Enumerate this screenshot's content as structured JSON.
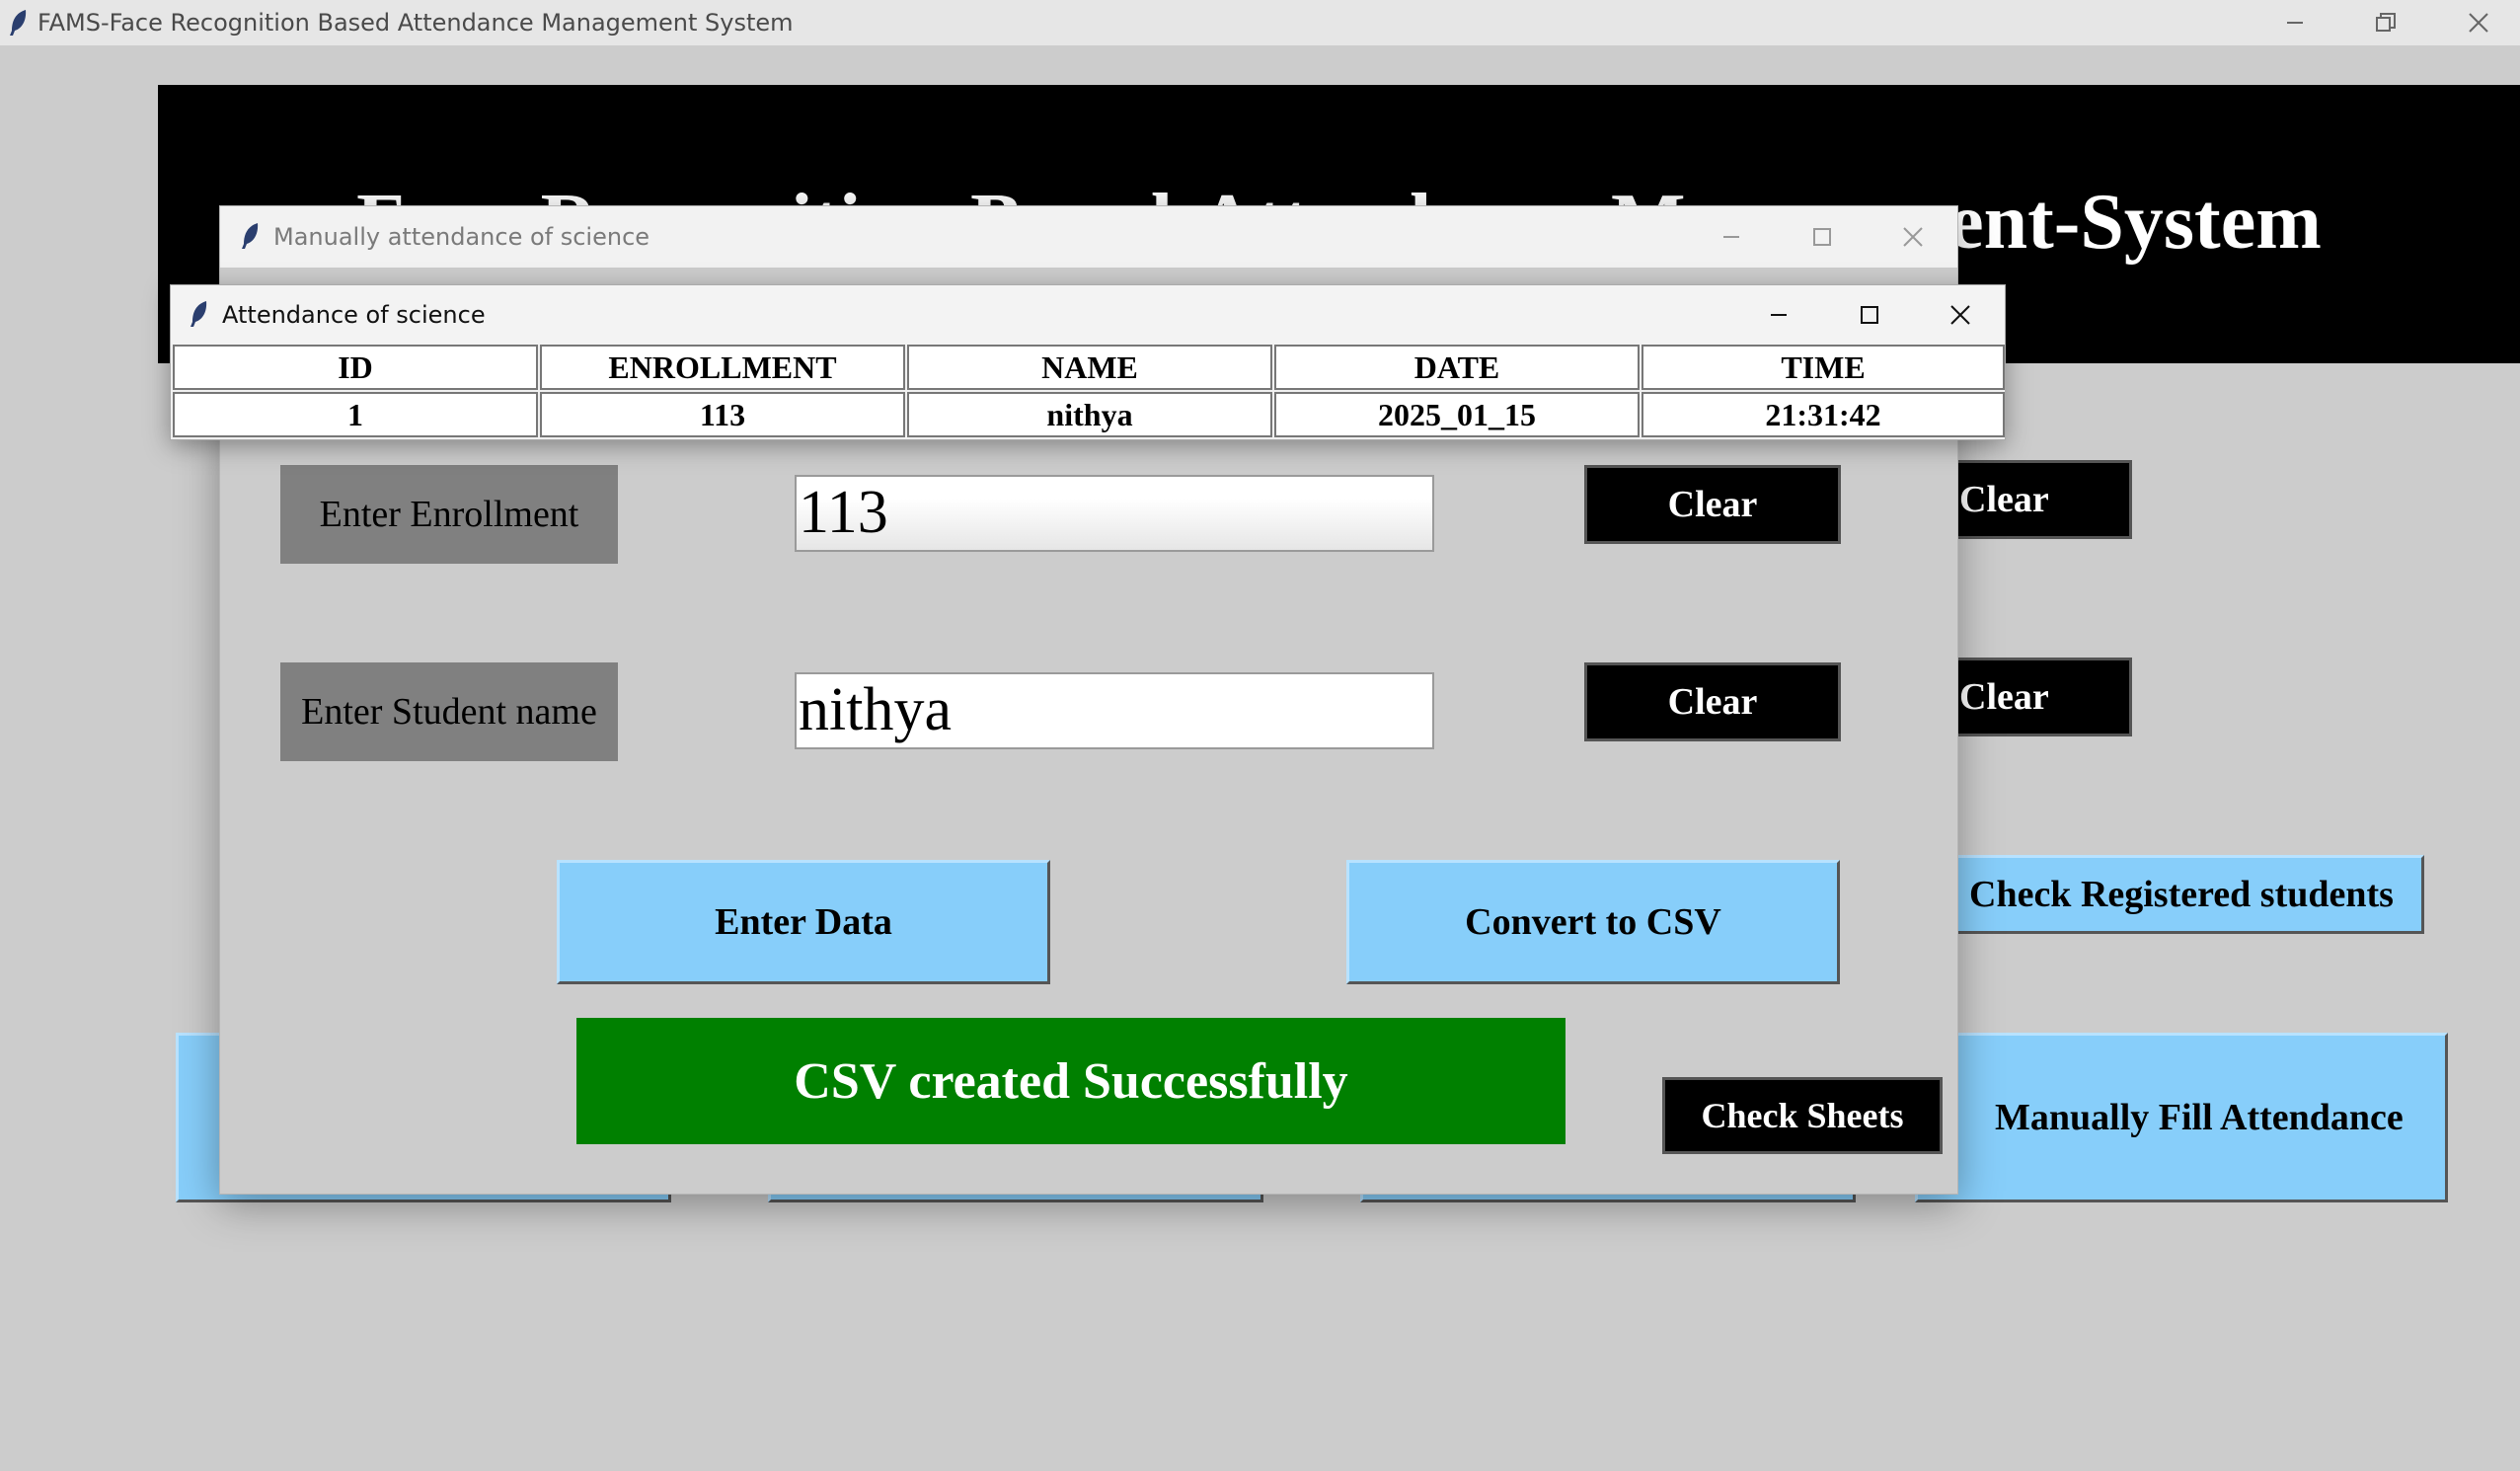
{
  "main_window": {
    "title": "FAMS-Face Recognition Based Attendance Management System",
    "header_title": "Face-Recognition-Based-Attendance-Management-System",
    "clear_label_1": "Clear",
    "clear_label_2": "Clear",
    "check_registered_label": "Check Registered students",
    "manually_fill_label": "Manually Fill Attendance"
  },
  "manual_window": {
    "title": "Manually attendance of science",
    "enrollment_label": "Enter Enrollment",
    "enrollment_value": "113",
    "student_name_label": "Enter Student name",
    "student_name_value": "nithya",
    "clear_enrollment_label": "Clear",
    "clear_name_label": "Clear",
    "enter_data_label": "Enter Data",
    "convert_csv_label": "Convert to CSV",
    "status_message": "CSV created Successfully",
    "check_sheets_label": "Check Sheets"
  },
  "attendance_window": {
    "title": "Attendance of science",
    "columns": [
      "ID",
      "ENROLLMENT",
      "NAME",
      "DATE",
      "TIME"
    ],
    "rows": [
      [
        "1",
        "113",
        "nithya",
        "2025_01_15",
        "21:31:42"
      ]
    ]
  },
  "colors": {
    "background": "#cccccc",
    "header_bg": "#000000",
    "light_blue_button": "#87cefa",
    "success_green": "#008000",
    "label_gray": "#808080"
  }
}
